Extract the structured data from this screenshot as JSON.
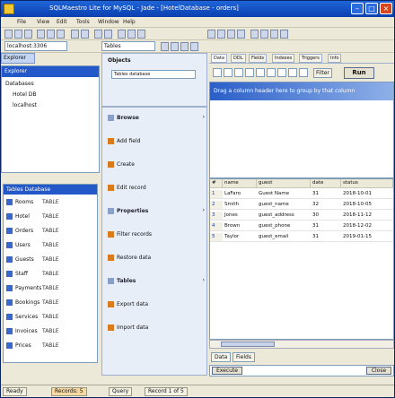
{
  "window": {
    "title": "SQLMaestro Lite for MySQL - Jade - [HotelDatabase - orders]"
  },
  "menu": [
    "File",
    "View",
    "Edit",
    "Tools",
    "Window",
    "Help"
  ],
  "toolbar2": {
    "db_select": "localhost:3306",
    "table_select": "Tables"
  },
  "left_tab": "Explorer",
  "db_tree": {
    "title": "Explorer",
    "items": [
      "Databases",
      "Hotel DB",
      "localhost"
    ]
  },
  "tables_pane": {
    "title": "Tables Database",
    "rows": [
      {
        "name": "Rooms",
        "type": "TABLE"
      },
      {
        "name": "Hotel",
        "type": "TABLE"
      },
      {
        "name": "Orders",
        "type": "TABLE"
      },
      {
        "name": "Users",
        "type": "TABLE"
      },
      {
        "name": "Guests",
        "type": "TABLE"
      },
      {
        "name": "Staff",
        "type": "TABLE"
      },
      {
        "name": "Payments",
        "type": "TABLE"
      },
      {
        "name": "Bookings",
        "type": "TABLE"
      },
      {
        "name": "Services",
        "type": "TABLE"
      },
      {
        "name": "Invoices",
        "type": "TABLE"
      },
      {
        "name": "Prices",
        "type": "TABLE"
      }
    ]
  },
  "mid_pane": {
    "header": "Objects",
    "field": "Tables database"
  },
  "actions": [
    {
      "label": "Browse",
      "header": true
    },
    {
      "label": "Add field"
    },
    {
      "label": "Create"
    },
    {
      "label": "Edit record"
    },
    {
      "label": "Properties",
      "header": true
    },
    {
      "label": "Filter records"
    },
    {
      "label": "Restore data"
    },
    {
      "label": "Tables",
      "header": true
    },
    {
      "label": "Export data"
    },
    {
      "label": "Import data"
    }
  ],
  "editor_tabs": [
    "Data",
    "DDL",
    "Fields",
    "Indexes",
    "Triggers",
    "Info"
  ],
  "controls": {
    "filter_label": "Filter",
    "run_label": "Run"
  },
  "editor": {
    "banner": "Drag a column header here to group by that column"
  },
  "grid": {
    "columns": [
      "#",
      "name",
      "guest",
      "date",
      "status"
    ],
    "rows": [
      [
        "1",
        "LaFaro",
        "Guest Name",
        "31",
        "2018-10-01"
      ],
      [
        "2",
        "Smith",
        "guest_name",
        "32",
        "2018-10-05"
      ],
      [
        "3",
        "Jones",
        "guest_address",
        "30",
        "2018-11-12"
      ],
      [
        "4",
        "Brown",
        "guest_phone",
        "31",
        "2018-12-02"
      ],
      [
        "5",
        "Taylor",
        "guest_email",
        "31",
        "2019-01-15"
      ]
    ]
  },
  "bottom_tabs": [
    "Data",
    "Fields"
  ],
  "sql_field": {
    "left_btn": "Execute",
    "right_btn": "Close"
  },
  "statusbar": [
    "Ready",
    "Records: 5",
    "Query",
    "Record 1 of 5"
  ]
}
